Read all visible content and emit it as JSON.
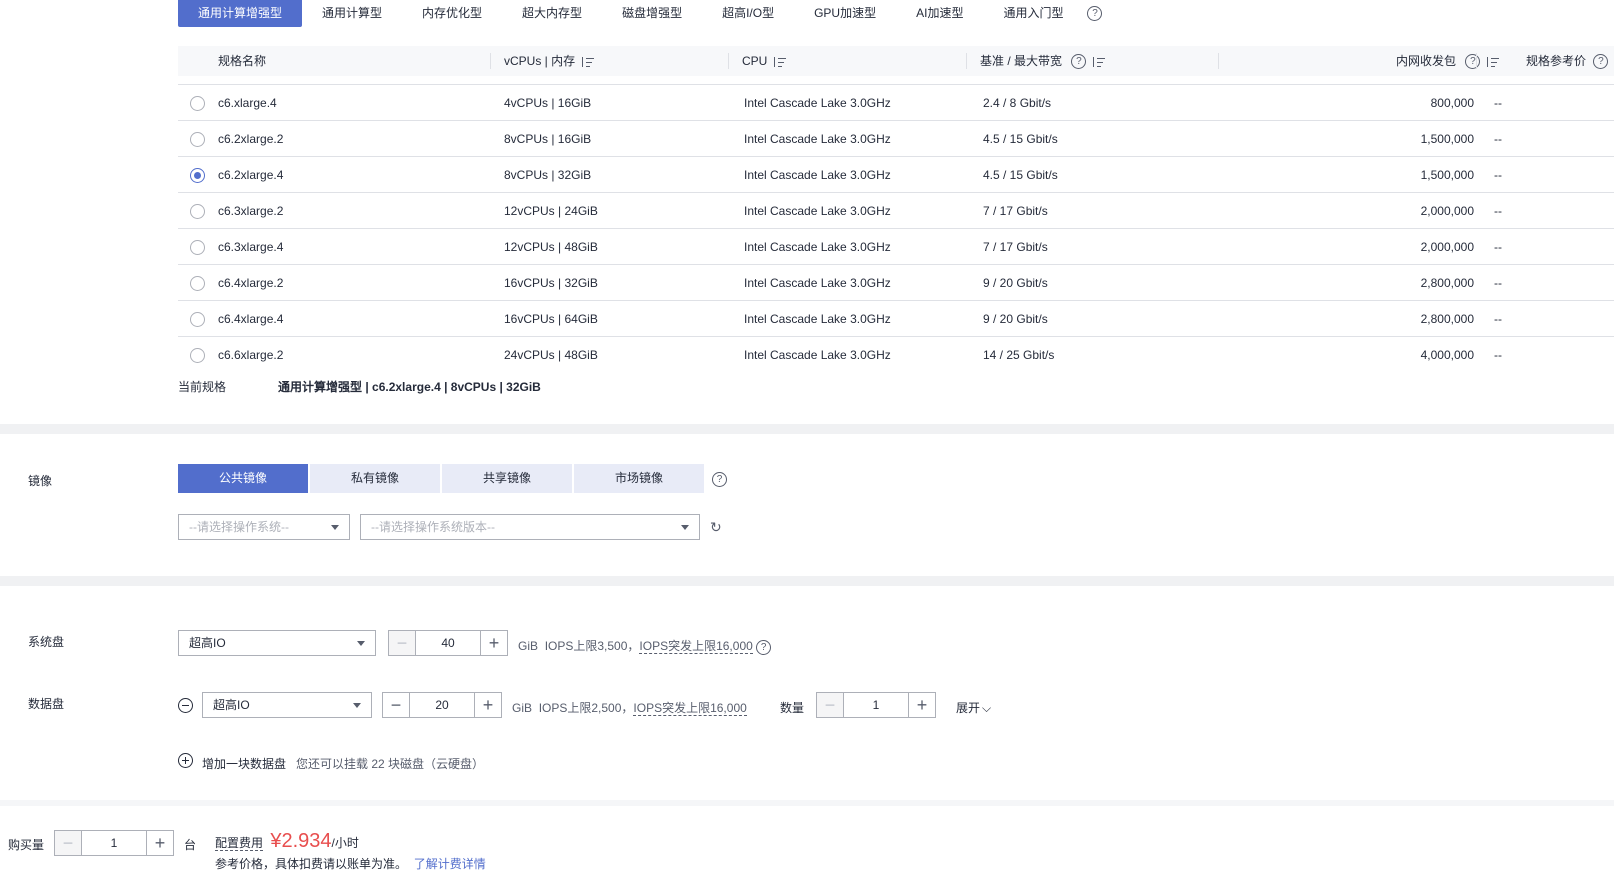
{
  "family_tabs": [
    "通用计算增强型",
    "通用计算型",
    "内存优化型",
    "超大内存型",
    "磁盘增强型",
    "超高I/O型",
    "GPU加速型",
    "AI加速型",
    "通用入门型"
  ],
  "table": {
    "headers": [
      "规格名称",
      "vCPUs | 内存",
      "CPU",
      "基准 / 最大带宽",
      "内网收发包",
      "规格参考价"
    ],
    "rows": [
      {
        "name": "c6.xlarge.4",
        "vcpu": "4vCPUs | 16GiB",
        "cpu": "Intel Cascade Lake 3.0GHz",
        "bw": "2.4 / 8 Gbit/s",
        "pps": "800,000",
        "price": "--",
        "selected": false
      },
      {
        "name": "c6.2xlarge.2",
        "vcpu": "8vCPUs | 16GiB",
        "cpu": "Intel Cascade Lake 3.0GHz",
        "bw": "4.5 / 15 Gbit/s",
        "pps": "1,500,000",
        "price": "--",
        "selected": false
      },
      {
        "name": "c6.2xlarge.4",
        "vcpu": "8vCPUs | 32GiB",
        "cpu": "Intel Cascade Lake 3.0GHz",
        "bw": "4.5 / 15 Gbit/s",
        "pps": "1,500,000",
        "price": "--",
        "selected": true
      },
      {
        "name": "c6.3xlarge.2",
        "vcpu": "12vCPUs | 24GiB",
        "cpu": "Intel Cascade Lake 3.0GHz",
        "bw": "7 / 17 Gbit/s",
        "pps": "2,000,000",
        "price": "--",
        "selected": false
      },
      {
        "name": "c6.3xlarge.4",
        "vcpu": "12vCPUs | 48GiB",
        "cpu": "Intel Cascade Lake 3.0GHz",
        "bw": "7 / 17 Gbit/s",
        "pps": "2,000,000",
        "price": "--",
        "selected": false
      },
      {
        "name": "c6.4xlarge.2",
        "vcpu": "16vCPUs | 32GiB",
        "cpu": "Intel Cascade Lake 3.0GHz",
        "bw": "9 / 20 Gbit/s",
        "pps": "2,800,000",
        "price": "--",
        "selected": false
      },
      {
        "name": "c6.4xlarge.4",
        "vcpu": "16vCPUs | 64GiB",
        "cpu": "Intel Cascade Lake 3.0GHz",
        "bw": "9 / 20 Gbit/s",
        "pps": "2,800,000",
        "price": "--",
        "selected": false
      },
      {
        "name": "c6.6xlarge.2",
        "vcpu": "24vCPUs | 48GiB",
        "cpu": "Intel Cascade Lake 3.0GHz",
        "bw": "14 / 25 Gbit/s",
        "pps": "4,000,000",
        "price": "--",
        "selected": false
      }
    ]
  },
  "current_spec": {
    "label": "当前规格",
    "value": "通用计算增强型 | c6.2xlarge.4 | 8vCPUs | 32GiB"
  },
  "image": {
    "label": "镜像",
    "tabs": [
      "公共镜像",
      "私有镜像",
      "共享镜像",
      "市场镜像"
    ],
    "os_placeholder": "--请选择操作系统--",
    "version_placeholder": "--请选择操作系统版本--"
  },
  "system_disk": {
    "label": "系统盘",
    "type": "超高IO",
    "size": "40",
    "unit": "GiB",
    "iops": "IOPS上限3,500，",
    "burst": "IOPS突发上限16,000"
  },
  "data_disk": {
    "label": "数据盘",
    "type": "超高IO",
    "size": "20",
    "unit": "GiB",
    "iops": "IOPS上限2,500，",
    "burst": "IOPS突发上限16,000",
    "count_label": "数量",
    "count": "1",
    "expand": "展开"
  },
  "add_disk": {
    "label": "增加一块数据盘",
    "note": "您还可以挂载 22 块磁盘（云硬盘）"
  },
  "purchase": {
    "label": "购买量",
    "count": "1",
    "unit": "台",
    "fee_label": "配置费用",
    "price": "¥2.934",
    "price_unit": "/小时",
    "note": "参考价格，具体扣费请以账单为准。",
    "link": "了解计费详情"
  },
  "colors": {
    "accent": "#526ecc",
    "price": "#e84e4e",
    "link": "#526ecc"
  }
}
